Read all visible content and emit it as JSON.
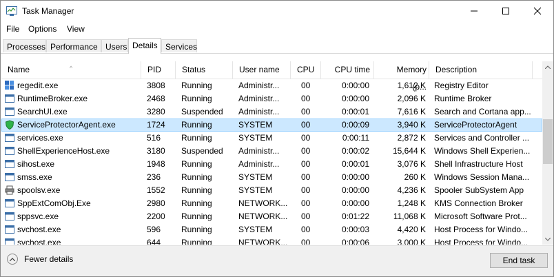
{
  "window": {
    "title": "Task Manager"
  },
  "menu": [
    "File",
    "Options",
    "View"
  ],
  "tabs": [
    "Processes",
    "Performance",
    "Users",
    "Details",
    "Services"
  ],
  "active_tab": "Details",
  "columns": [
    "Name",
    "PID",
    "Status",
    "User name",
    "CPU",
    "CPU time",
    "Memory (p...",
    "Description"
  ],
  "sort_indicator": "^",
  "rows": [
    {
      "name": "regedit.exe",
      "pid": "3808",
      "status": "Running",
      "user": "Administr...",
      "cpu": "00",
      "cputime": "0:00:00",
      "memory": "1,612 K",
      "desc": "Registry Editor",
      "icon": "registry-icon"
    },
    {
      "name": "RuntimeBroker.exe",
      "pid": "2468",
      "status": "Running",
      "user": "Administr...",
      "cpu": "00",
      "cputime": "0:00:00",
      "memory": "2,096 K",
      "desc": "Runtime Broker",
      "icon": "window-icon"
    },
    {
      "name": "SearchUI.exe",
      "pid": "3280",
      "status": "Suspended",
      "user": "Administr...",
      "cpu": "00",
      "cputime": "0:00:01",
      "memory": "7,616 K",
      "desc": "Search and Cortana app...",
      "icon": "window-icon"
    },
    {
      "name": "ServiceProtectorAgent.exe",
      "pid": "1724",
      "status": "Running",
      "user": "SYSTEM",
      "cpu": "00",
      "cputime": "0:00:09",
      "memory": "3,940 K",
      "desc": "ServiceProtectorAgent",
      "icon": "shield-icon",
      "selected": true
    },
    {
      "name": "services.exe",
      "pid": "516",
      "status": "Running",
      "user": "SYSTEM",
      "cpu": "00",
      "cputime": "0:00:11",
      "memory": "2,872 K",
      "desc": "Services and Controller ...",
      "icon": "window-icon"
    },
    {
      "name": "ShellExperienceHost.exe",
      "pid": "3180",
      "status": "Suspended",
      "user": "Administr...",
      "cpu": "00",
      "cputime": "0:00:02",
      "memory": "15,644 K",
      "desc": "Windows Shell Experien...",
      "icon": "window-icon"
    },
    {
      "name": "sihost.exe",
      "pid": "1948",
      "status": "Running",
      "user": "Administr...",
      "cpu": "00",
      "cputime": "0:00:01",
      "memory": "3,076 K",
      "desc": "Shell Infrastructure Host",
      "icon": "window-icon"
    },
    {
      "name": "smss.exe",
      "pid": "236",
      "status": "Running",
      "user": "SYSTEM",
      "cpu": "00",
      "cputime": "0:00:00",
      "memory": "260 K",
      "desc": "Windows Session Mana...",
      "icon": "window-icon"
    },
    {
      "name": "spoolsv.exe",
      "pid": "1552",
      "status": "Running",
      "user": "SYSTEM",
      "cpu": "00",
      "cputime": "0:00:00",
      "memory": "4,236 K",
      "desc": "Spooler SubSystem App",
      "icon": "printer-icon"
    },
    {
      "name": "SppExtComObj.Exe",
      "pid": "2980",
      "status": "Running",
      "user": "NETWORK...",
      "cpu": "00",
      "cputime": "0:00:00",
      "memory": "1,248 K",
      "desc": "KMS Connection Broker",
      "icon": "window-icon"
    },
    {
      "name": "sppsvc.exe",
      "pid": "2200",
      "status": "Running",
      "user": "NETWORK...",
      "cpu": "00",
      "cputime": "0:01:22",
      "memory": "11,068 K",
      "desc": "Microsoft Software Prot...",
      "icon": "window-icon"
    },
    {
      "name": "svchost.exe",
      "pid": "596",
      "status": "Running",
      "user": "SYSTEM",
      "cpu": "00",
      "cputime": "0:00:03",
      "memory": "4,420 K",
      "desc": "Host Process for Windo...",
      "icon": "window-icon"
    },
    {
      "name": "svchost.exe",
      "pid": "644",
      "status": "Running",
      "user": "NETWORK...",
      "cpu": "00",
      "cputime": "0:00:06",
      "memory": "3,000 K",
      "desc": "Host Process for Windo...",
      "icon": "window-icon"
    }
  ],
  "footer": {
    "fewer_details": "Fewer details",
    "end_task": "End task"
  },
  "colors": {
    "selection": "#cce8ff",
    "selection_border": "#99d1ff",
    "footer_bg": "#f0f0f0"
  }
}
